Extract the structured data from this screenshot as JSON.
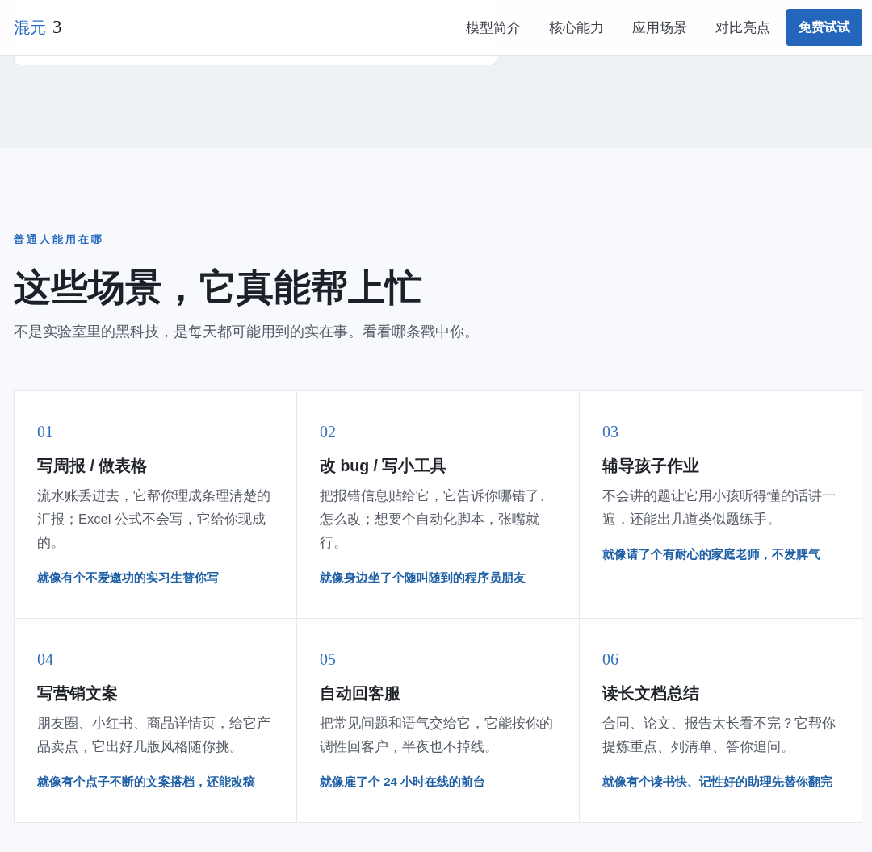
{
  "header": {
    "logo": {
      "name": "混元",
      "version": "3"
    },
    "nav": [
      "模型简介",
      "核心能力",
      "应用场景",
      "对比亮点"
    ],
    "cta": "免费试试"
  },
  "section": {
    "eyebrow": "普通人能用在哪",
    "title": "这些场景，它真能帮上忙",
    "subtitle": "不是实验室里的黑科技，是每天都可能用到的实在事。看看哪条戳中你。",
    "scenarios": [
      {
        "number": "01",
        "title": "写周报 / 做表格",
        "description": "流水账丢进去，它帮你理成条理清楚的汇报；Excel 公式不会写，它给你现成的。",
        "tagline": "就像有个不爱邀功的实习生替你写"
      },
      {
        "number": "02",
        "title": "改 bug / 写小工具",
        "description": "把报错信息贴给它，它告诉你哪错了、怎么改；想要个自动化脚本，张嘴就行。",
        "tagline": "就像身边坐了个随叫随到的程序员朋友"
      },
      {
        "number": "03",
        "title": "辅导孩子作业",
        "description": "不会讲的题让它用小孩听得懂的话讲一遍，还能出几道类似题练手。",
        "tagline": "就像请了个有耐心的家庭老师，不发脾气"
      },
      {
        "number": "04",
        "title": "写营销文案",
        "description": "朋友圈、小红书、商品详情页，给它产品卖点，它出好几版风格随你挑。",
        "tagline": "就像有个点子不断的文案搭档，还能改稿"
      },
      {
        "number": "05",
        "title": "自动回客服",
        "description": "把常见问题和语气交给它，它能按你的调性回客户，半夜也不掉线。",
        "tagline": "就像雇了个 24 小时在线的前台"
      },
      {
        "number": "06",
        "title": "读长文档总结",
        "description": "合同、论文、报告太长看不完？它帮你提炼重点、列清单、答你追问。",
        "tagline": "就像有个读书快、记性好的助理先替你翻完"
      }
    ]
  }
}
